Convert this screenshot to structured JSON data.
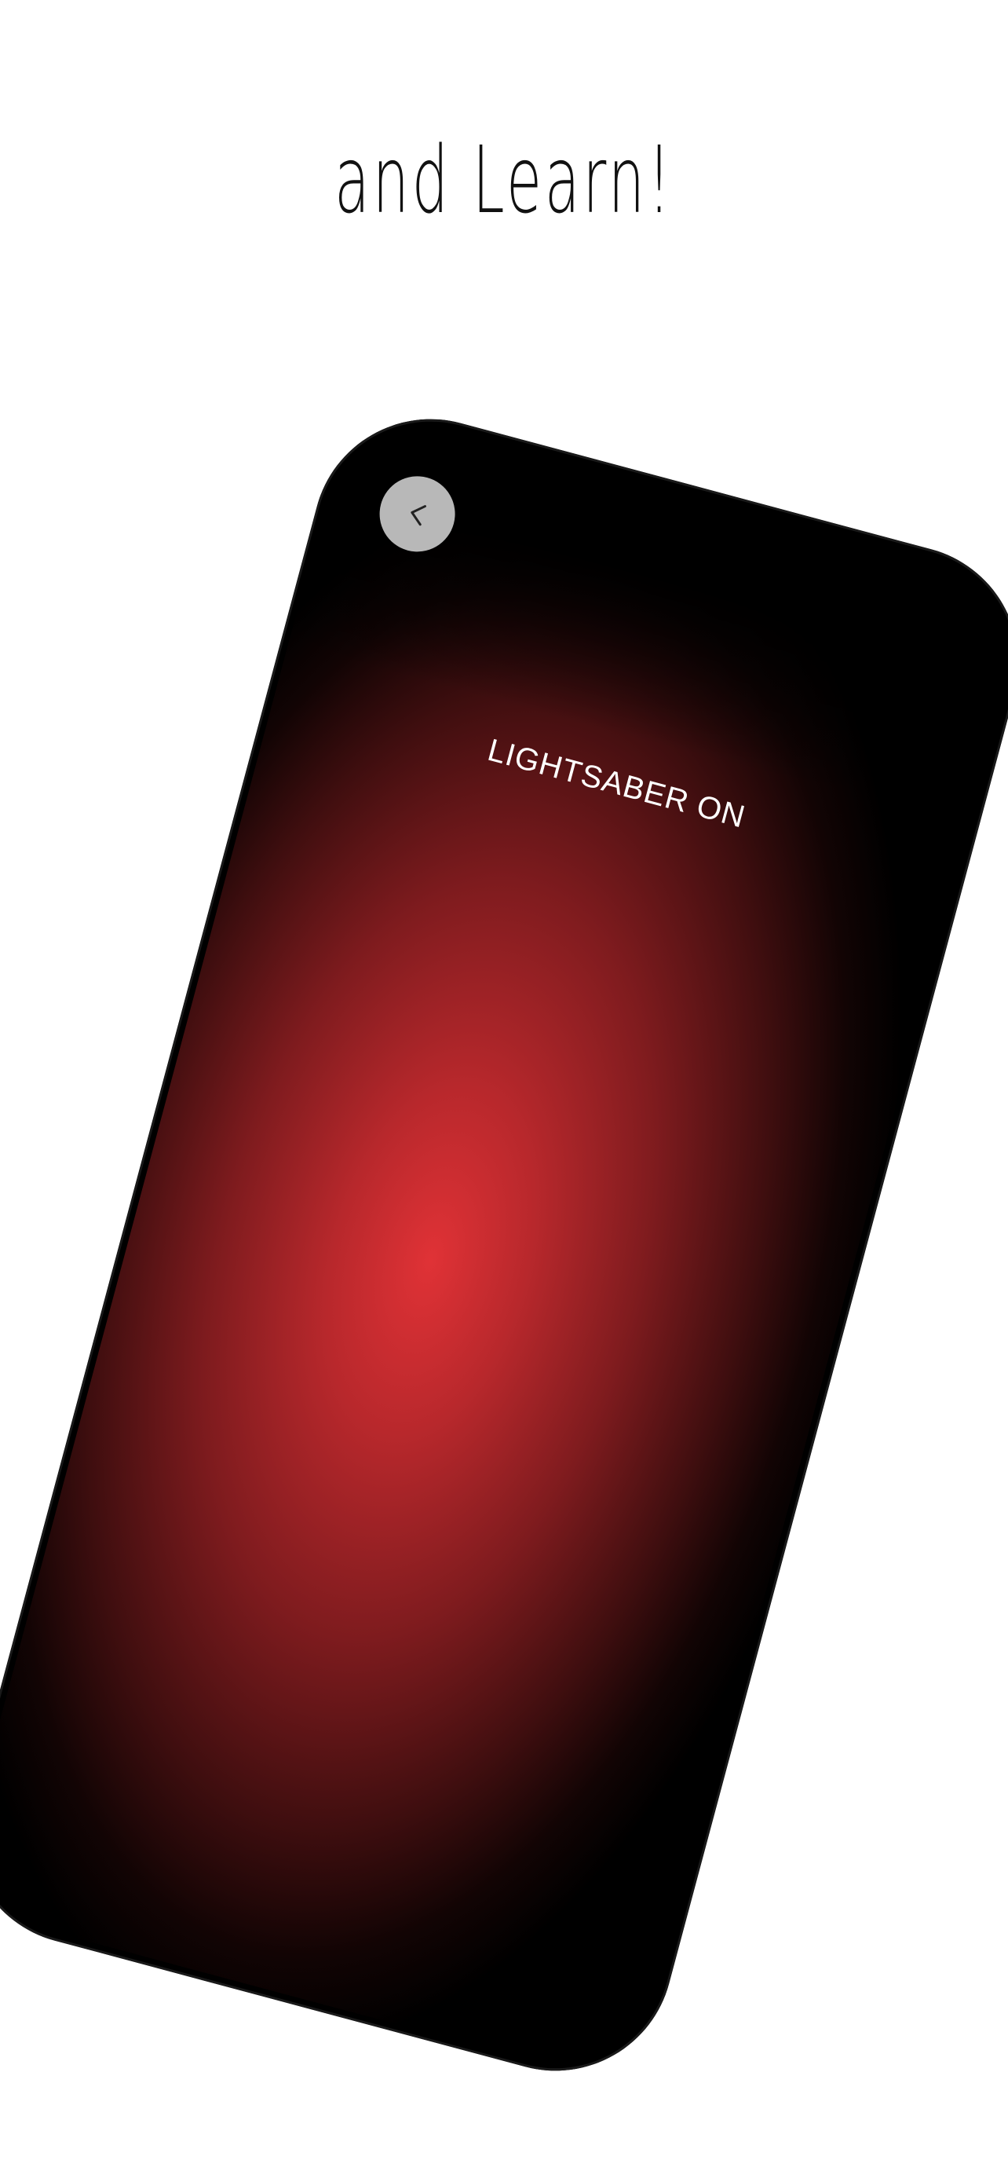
{
  "headline": "and Learn!",
  "phone": {
    "back_button_icon": "chevron-left-icon",
    "status_label": "LIGHTSABER ON",
    "glow_color": "#e03236",
    "background_color": "#000000"
  }
}
